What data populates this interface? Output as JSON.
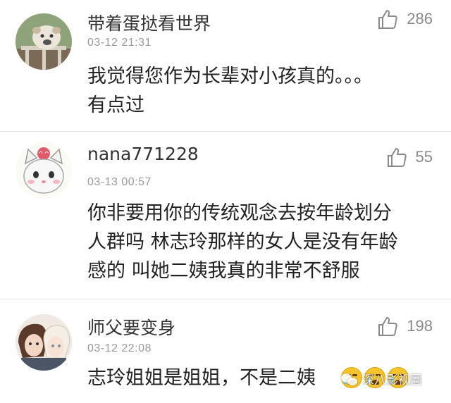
{
  "comments": [
    {
      "username": "带着蛋挞看世界",
      "timestamp": "03-12 21:31",
      "likes": "286",
      "body_lines": [
        "我觉得您作为长辈对小孩真的。。。",
        "有点过"
      ],
      "avatar_icon": "bulldog-avatar"
    },
    {
      "username": "nana771228",
      "timestamp": "03-13 00:57",
      "likes": "55",
      "body_lines": [
        "你非要用你的传统观念去按年龄划分",
        "人群吗 林志玲那样的女人是没有年龄",
        "感的 叫她二姨我真的非常不舒服"
      ],
      "avatar_icon": "cartoon-cat-avatar"
    },
    {
      "username": "师父要变身",
      "timestamp": "03-12 22:08",
      "likes": "198",
      "body_lines": [
        "志玲姐姐是姐姐，不是二姨"
      ],
      "avatar_icon": "anime-boys-avatar"
    }
  ],
  "emojis": [
    "crying-face-emoji",
    "crying-face-emoji",
    "crying-face-emoji"
  ],
  "watermark": "深八影视圈",
  "colors": {
    "text": "#222222",
    "meta": "#9a9a9a",
    "icon": "#8a8a8a",
    "divider": "#e3e3e3"
  }
}
